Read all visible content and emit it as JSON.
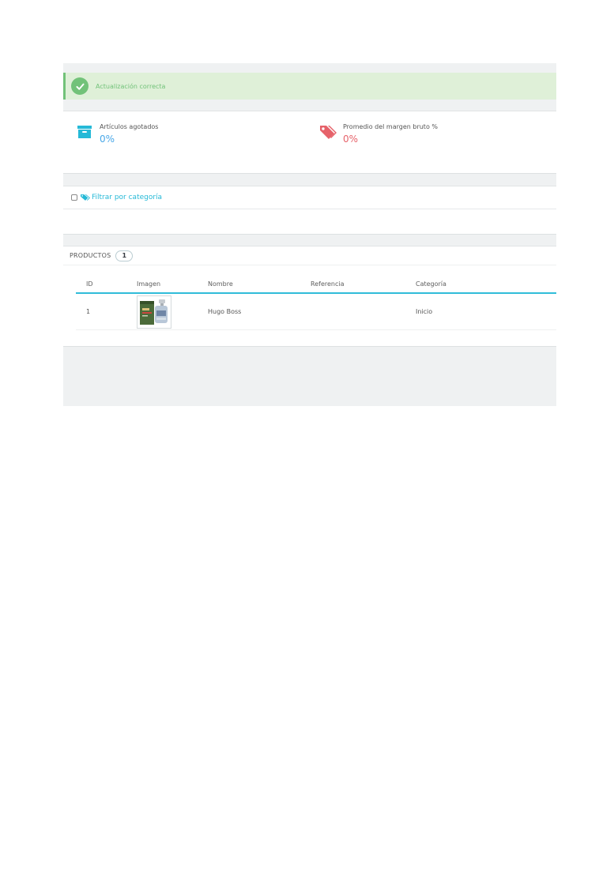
{
  "alert": {
    "text": "Actualización correcta",
    "icon": "check-circle-icon"
  },
  "kpis": [
    {
      "label": "Artículos agotados",
      "value": "0%",
      "icon": "archive-box-icon",
      "color": "#25b9d7"
    },
    {
      "label": "Promedio del margen bruto %",
      "value": "0%",
      "icon": "tags-icon",
      "color": "#e6626a"
    }
  ],
  "filter": {
    "label": "Filtrar por categoría",
    "icon": "tags-icon",
    "checked": false
  },
  "products": {
    "title": "PRODUCTOS",
    "count": "1",
    "columns": [
      "ID",
      "Imagen",
      "Nombre",
      "Referencia",
      "Categoría"
    ],
    "rows": [
      {
        "id": "1",
        "image": "perfume-thumbnail",
        "name": "Hugo Boss",
        "reference": "",
        "category": "Inicio"
      }
    ]
  },
  "colors": {
    "accent": "#25b9d7",
    "success": "#72c279",
    "danger": "#e6626a",
    "background": "#eff1f2"
  }
}
